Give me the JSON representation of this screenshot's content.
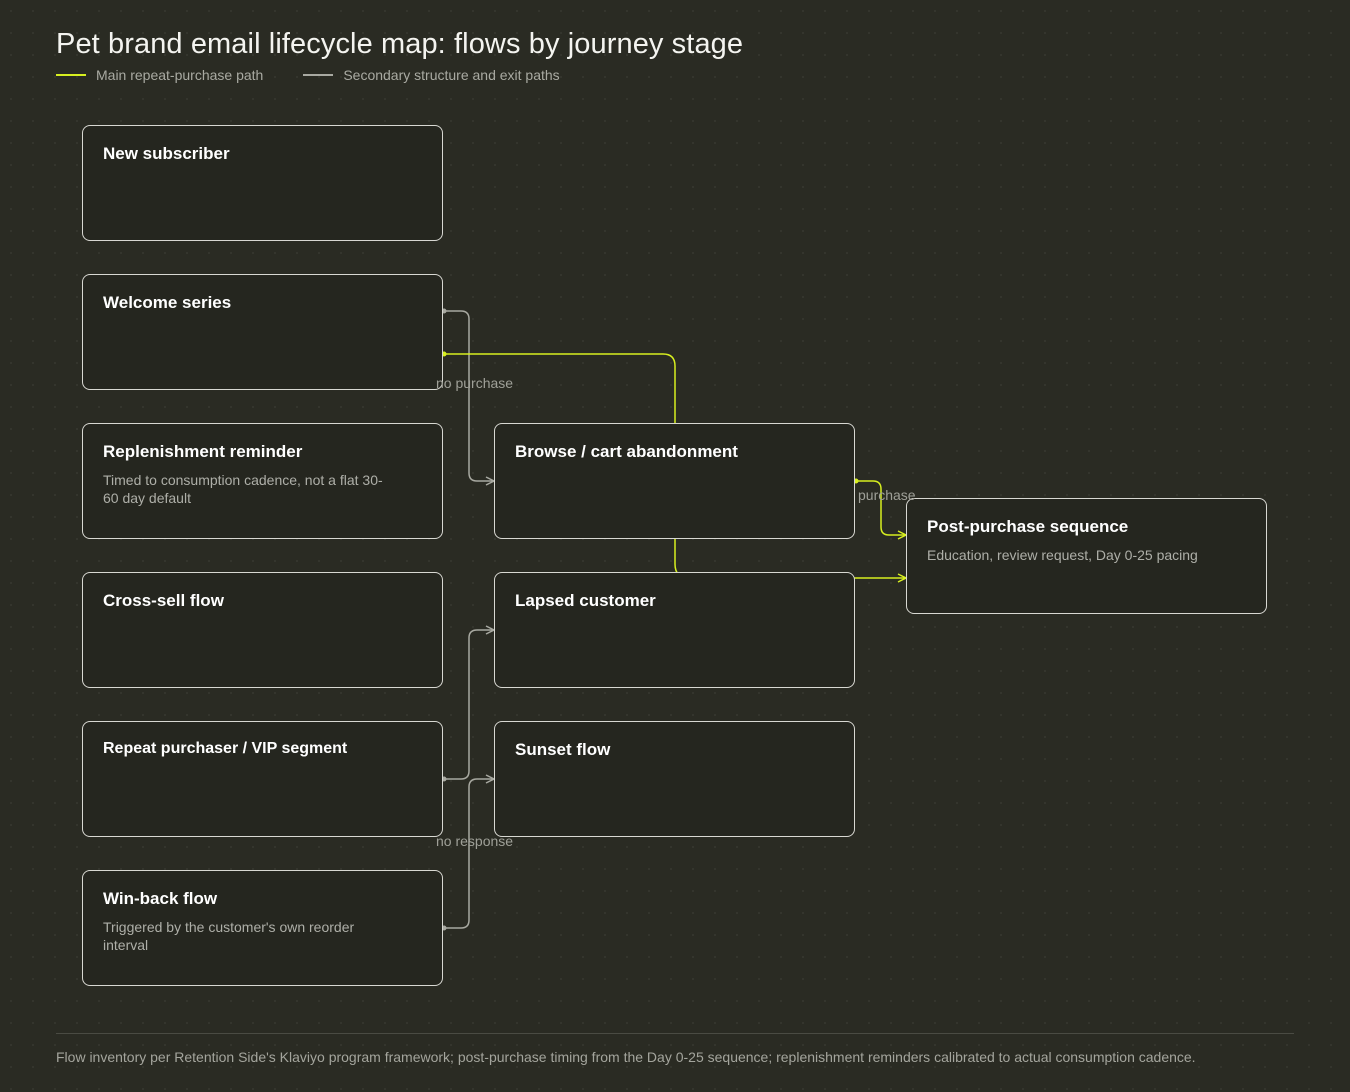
{
  "title": "Pet brand email lifecycle map: flows by journey stage",
  "legend": {
    "main_label": "Main repeat-purchase path",
    "secondary_label": "Secondary structure and exit paths",
    "main_color": "#d7ef20",
    "secondary_color": "#a8a9a1"
  },
  "nodes": {
    "new_subscriber": {
      "title": "New subscriber",
      "desc": ""
    },
    "welcome_series": {
      "title": "Welcome series",
      "desc": ""
    },
    "replenishment_reminder": {
      "title": "Replenishment reminder",
      "desc": "Timed to consumption cadence, not a flat 30-60 day default"
    },
    "cross_sell_flow": {
      "title": "Cross-sell flow",
      "desc": ""
    },
    "repeat_purchaser": {
      "title": "Repeat purchaser / VIP segment",
      "desc": ""
    },
    "win_back_flow": {
      "title": "Win-back flow",
      "desc": "Triggered by the customer's own reorder interval"
    },
    "browse_cart": {
      "title": "Browse / cart abandonment",
      "desc": ""
    },
    "lapsed_customer": {
      "title": "Lapsed customer",
      "desc": ""
    },
    "sunset_flow": {
      "title": "Sunset flow",
      "desc": ""
    },
    "post_purchase": {
      "title": "Post-purchase sequence",
      "desc": "Education, review request, Day 0-25 pacing"
    }
  },
  "edge_labels": {
    "no_purchase": "no purchase",
    "purchase": "purchase",
    "no_response": "no response"
  },
  "footer": "Flow inventory per Retention Side's Klaviyo program framework; post-purchase timing from the Day 0-25 sequence; replenishment reminders calibrated to actual consumption cadence."
}
